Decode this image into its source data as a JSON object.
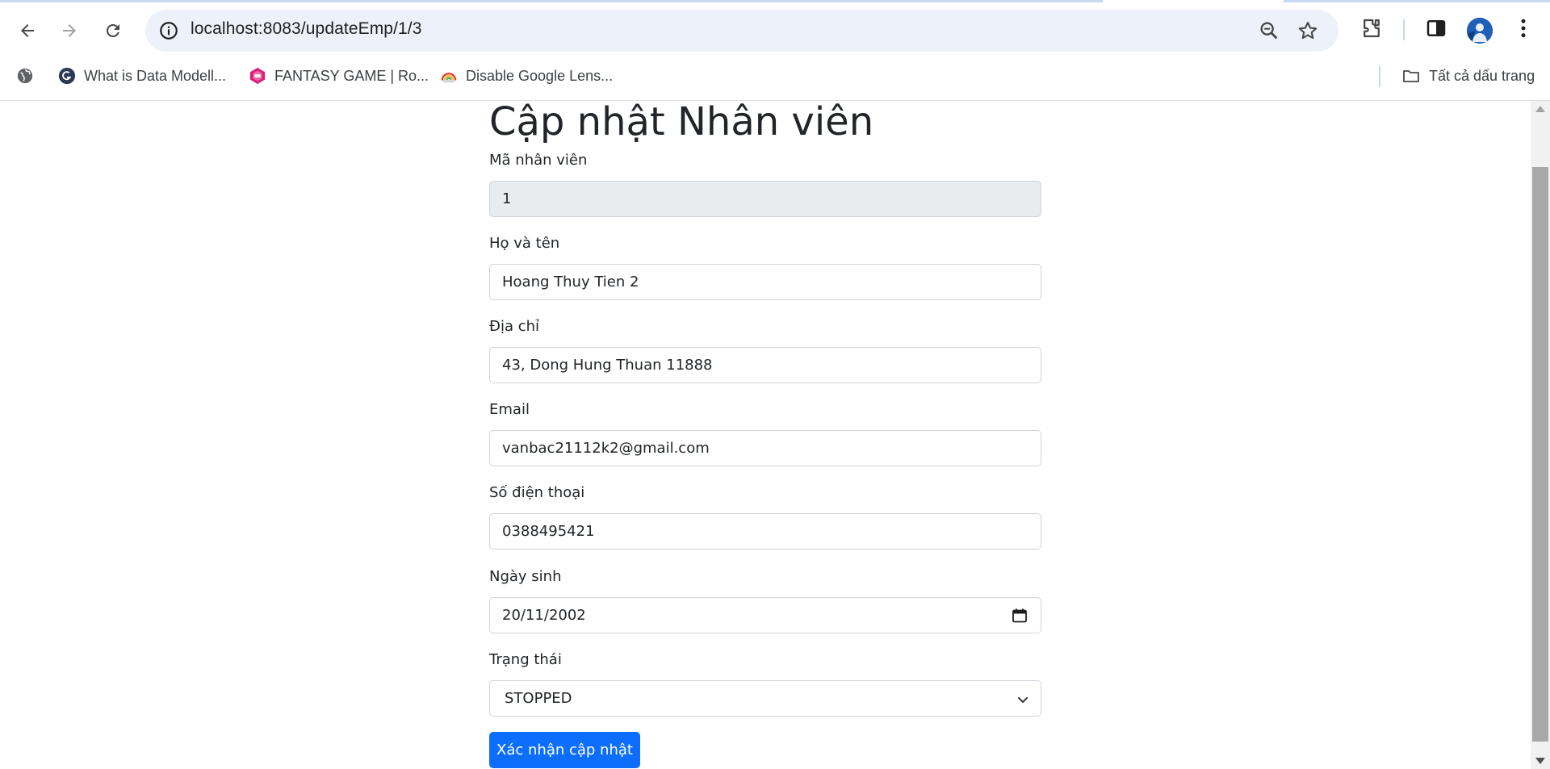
{
  "browser": {
    "url": "localhost:8083/updateEmp/1/3",
    "bookmarks": [
      {
        "label": "What is Data Modell...",
        "icon": "data-modelling-favicon-icon"
      },
      {
        "label": "FANTASY GAME | Ro...",
        "icon": "fantasy-game-favicon-icon"
      },
      {
        "label": "Disable Google Lens...",
        "icon": "rainbow-favicon-icon"
      }
    ],
    "all_bookmarks": "Tất cả dấu trang",
    "accent": "#1a73e8"
  },
  "form": {
    "title": "Cập nhật Nhân viên",
    "fields": {
      "id": {
        "label": "Mã nhân viên",
        "value": "1"
      },
      "name": {
        "label": "Họ và tên",
        "value": "Hoang Thuy Tien 2"
      },
      "address": {
        "label": "Địa chỉ",
        "value": "43, Dong Hung Thuan 11888"
      },
      "email": {
        "label": "Email",
        "value": "vanbac21112k2@gmail.com"
      },
      "phone": {
        "label": "Số điện thoại",
        "value": "0388495421"
      },
      "dob": {
        "label": "Ngày sinh",
        "value": "20/11/2002"
      },
      "status": {
        "label": "Trạng thái",
        "value": "STOPPED"
      }
    },
    "submit_label": "Xác nhận cập nhật",
    "primary_color": "#0d6efd"
  }
}
